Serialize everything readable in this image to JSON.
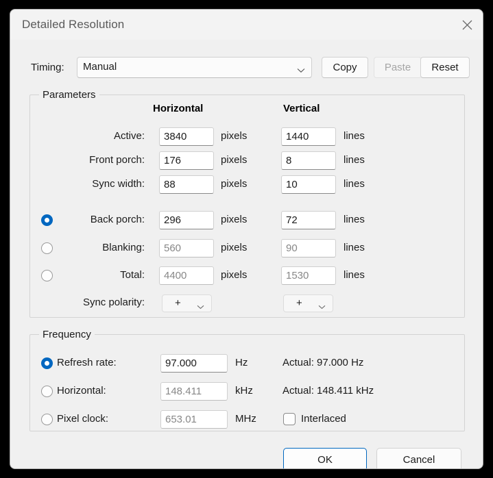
{
  "window": {
    "title": "Detailed Resolution",
    "close_icon": "close-icon"
  },
  "toolbar": {
    "timing_label": "Timing:",
    "timing_value": "Manual",
    "timing_chevron": "chevron-down-icon",
    "copy_label": "Copy",
    "paste_label": "Paste",
    "reset_label": "Reset"
  },
  "parameters": {
    "legend": "Parameters",
    "col_horizontal": "Horizontal",
    "col_vertical": "Vertical",
    "unit_h": "pixels",
    "unit_v": "lines",
    "rows": [
      {
        "label": "Active:",
        "radio": false,
        "selected": false,
        "h": "3840",
        "v": "1440",
        "readonly": false
      },
      {
        "label": "Front porch:",
        "radio": false,
        "selected": false,
        "h": "176",
        "v": "8",
        "readonly": false
      },
      {
        "label": "Sync width:",
        "radio": false,
        "selected": false,
        "h": "88",
        "v": "10",
        "readonly": false
      },
      {
        "label": "Back porch:",
        "radio": true,
        "selected": true,
        "h": "296",
        "v": "72",
        "readonly": false
      },
      {
        "label": "Blanking:",
        "radio": true,
        "selected": false,
        "h": "560",
        "v": "90",
        "readonly": true
      },
      {
        "label": "Total:",
        "radio": true,
        "selected": false,
        "h": "4400",
        "v": "1530",
        "readonly": true
      }
    ],
    "sync_polarity_label": "Sync polarity:",
    "sync_polarity_h": "+",
    "sync_polarity_v": "+",
    "sync_polarity_chevron": "chevron-down-icon"
  },
  "frequency": {
    "legend": "Frequency",
    "rows": [
      {
        "label": "Refresh rate:",
        "selected": true,
        "value": "97.000",
        "unit": "Hz",
        "actual": "Actual: 97.000 Hz",
        "readonly": false
      },
      {
        "label": "Horizontal:",
        "selected": false,
        "value": "148.411",
        "unit": "kHz",
        "actual": "Actual: 148.411 kHz",
        "readonly": true
      },
      {
        "label": "Pixel clock:",
        "selected": false,
        "value": "653.01",
        "unit": "MHz",
        "actual": "",
        "readonly": true
      }
    ],
    "interlaced_label": "Interlaced",
    "interlaced_checked": false
  },
  "footer": {
    "ok_label": "OK",
    "cancel_label": "Cancel"
  },
  "colors": {
    "accent": "#0067c0",
    "dialog_bg": "#f0f0f0",
    "titlebar_bg": "#f3f3f3",
    "text": "#1b1b1b",
    "disabled_text": "#a5a5a5",
    "readonly_text": "#878787"
  }
}
